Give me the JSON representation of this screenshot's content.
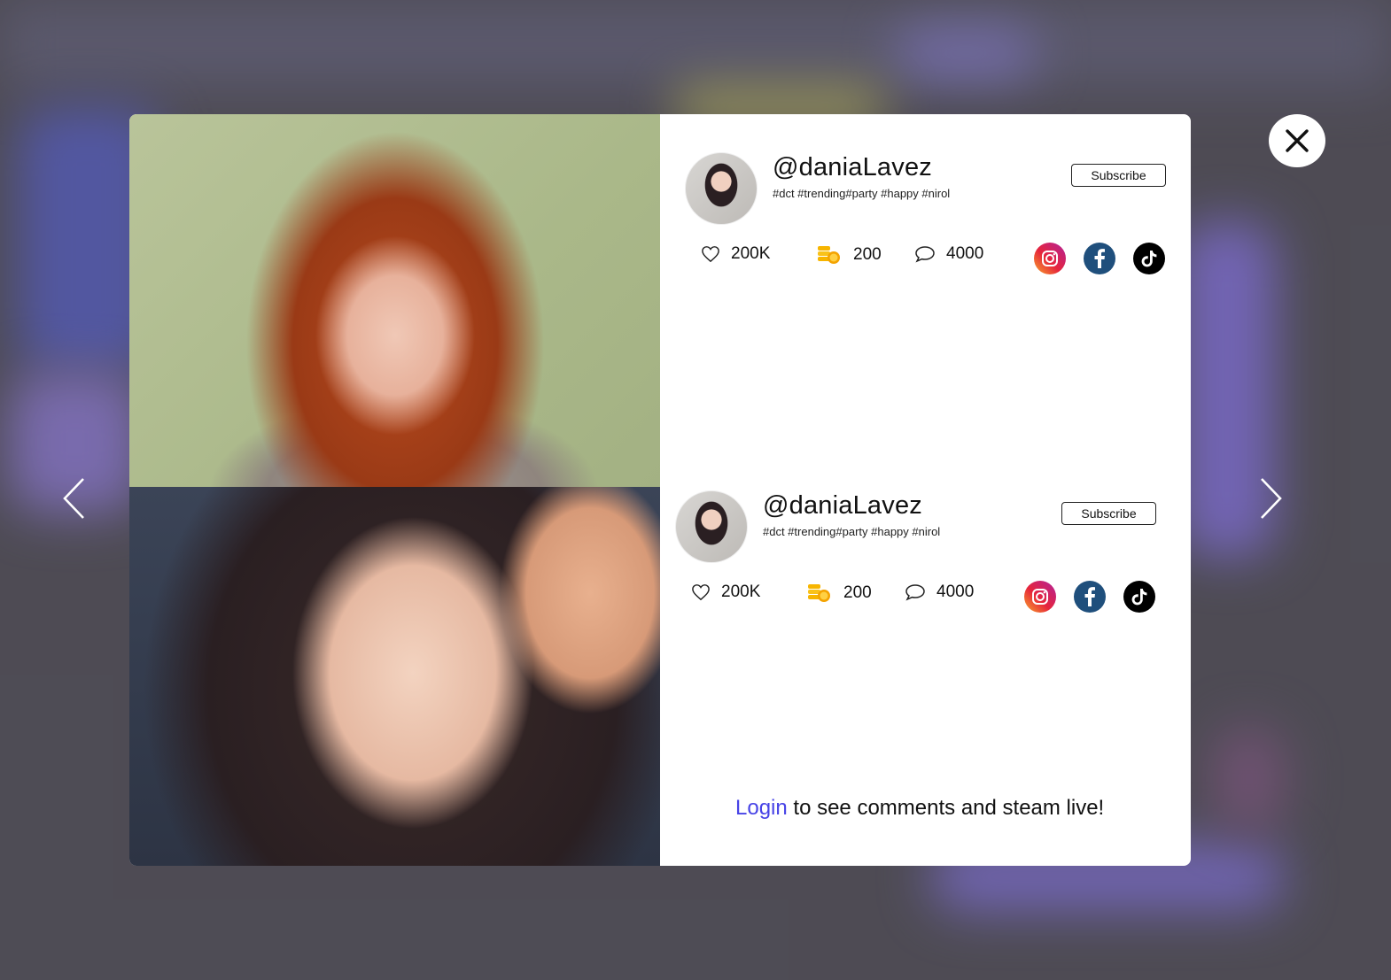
{
  "posts": [
    {
      "username": "@daniaLavez",
      "hashtags": "#dct #trending#party #happy #nirol",
      "subscribe_label": "Subscribe",
      "stats": {
        "likes": "200K",
        "coins": "200",
        "comments": "4000"
      },
      "social": [
        "instagram-icon",
        "facebook-icon",
        "tiktok-icon"
      ]
    },
    {
      "username": "@daniaLavez",
      "hashtags": "#dct #trending#party #happy #nirol",
      "subscribe_label": "Subscribe",
      "stats": {
        "likes": "200K",
        "coins": "200",
        "comments": "4000"
      },
      "social": [
        "instagram-icon",
        "facebook-icon",
        "tiktok-icon"
      ]
    }
  ],
  "footer": {
    "login_link": "Login",
    "login_text": " to see comments and steam live!"
  },
  "icons": {
    "close": "close-icon",
    "prev": "chevron-left-icon",
    "next": "chevron-right-icon",
    "like": "heart-icon",
    "coins": "coins-icon",
    "comment": "comment-icon"
  },
  "colors": {
    "accent_link": "#4743e6",
    "facebook": "#1f4f7c",
    "tiktok": "#000000"
  }
}
